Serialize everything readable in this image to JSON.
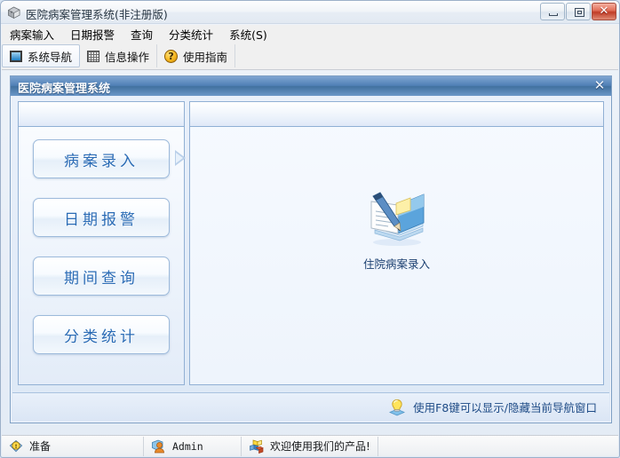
{
  "window": {
    "title": "医院病案管理系统(非注册版)",
    "app_icon": "application-box-icon",
    "buttons": {
      "minimize": "minimize-icon",
      "maximize": "maximize-icon",
      "close": "✕"
    }
  },
  "menubar": {
    "items": [
      {
        "label": "病案输入"
      },
      {
        "label": "日期报警"
      },
      {
        "label": "查询"
      },
      {
        "label": "分类统计"
      },
      {
        "label": "系统(S)"
      }
    ]
  },
  "toolbar": {
    "items": [
      {
        "label": "系统导航",
        "icon": "navigator-icon",
        "active": true
      },
      {
        "label": "信息操作",
        "icon": "grid-icon",
        "active": false
      },
      {
        "label": "使用指南",
        "icon": "help-question-icon",
        "active": false
      }
    ]
  },
  "panel": {
    "caption": "医院病案管理系统",
    "close_glyph": "✕"
  },
  "navigation": {
    "buttons": [
      {
        "label": "病案录入",
        "selected": true
      },
      {
        "label": "日期报警",
        "selected": false
      },
      {
        "label": "期间查询",
        "selected": false
      },
      {
        "label": "分类统计",
        "selected": false
      }
    ]
  },
  "content": {
    "shortcut": {
      "label": "住院病案录入",
      "icon": "notepad-with-pen-icon"
    }
  },
  "tipbar": {
    "icon": "lightbulb-icon",
    "text": "使用F8键可以显示/隐藏当前导航窗口"
  },
  "statusbar": {
    "cells": [
      {
        "icon": "ready-status-icon",
        "text": "准备"
      },
      {
        "icon": "user-icon",
        "text": "Admin"
      },
      {
        "icon": "cubes-icon",
        "text": "欢迎使用我们的产品!"
      }
    ]
  },
  "colors": {
    "accent_blue": "#2a6bb5",
    "panel_caption": "#4f7fb5",
    "close_red": "#c03c26",
    "tip_text": "#1e4b86"
  }
}
